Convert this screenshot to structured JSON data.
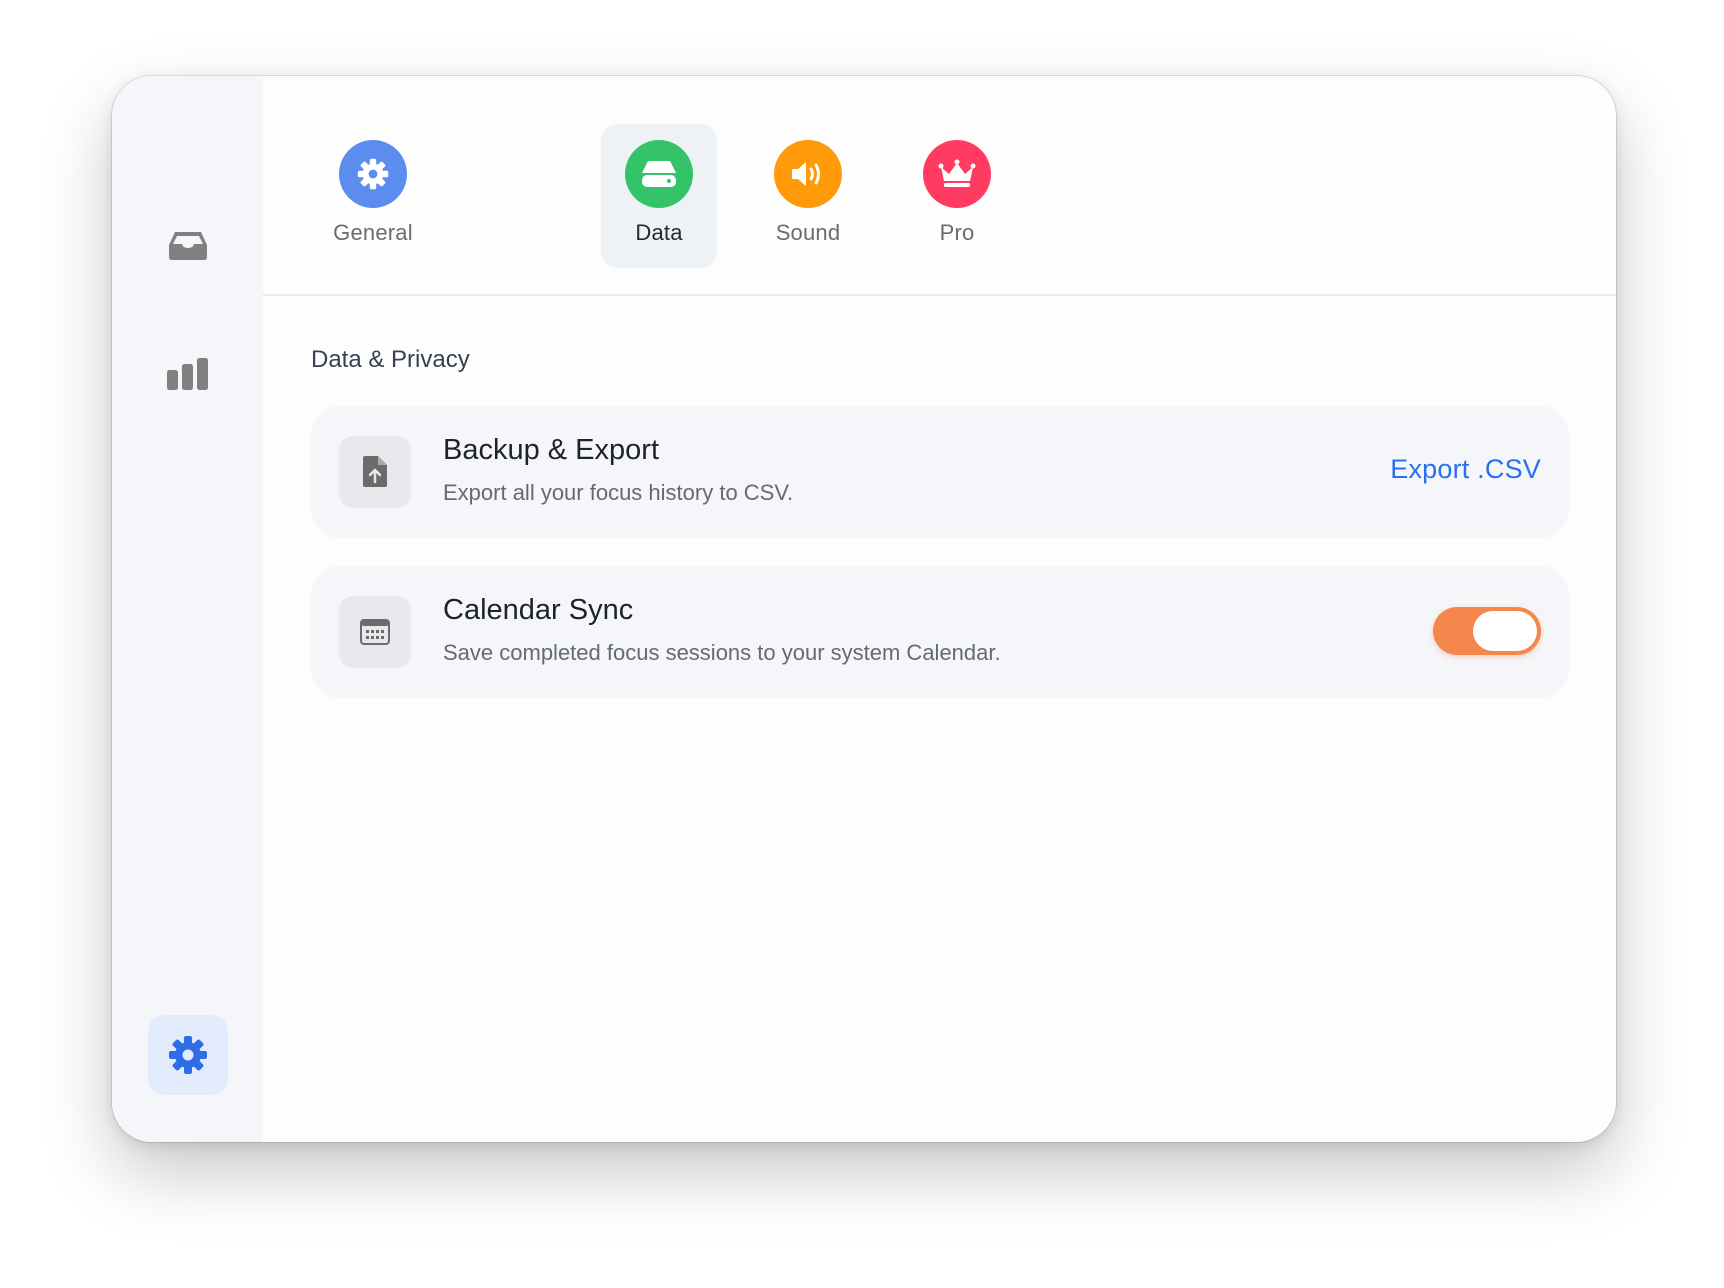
{
  "window": {
    "traffic_lights": [
      "close",
      "minimize",
      "zoom"
    ]
  },
  "sidebar": {
    "items": [
      {
        "name": "inbox",
        "icon": "inbox-tray-icon",
        "active": false
      },
      {
        "name": "stats",
        "icon": "bar-chart-icon",
        "active": false
      },
      {
        "name": "settings",
        "icon": "gear-icon",
        "active": true
      }
    ]
  },
  "tabs": [
    {
      "label": "General",
      "icon": "gear-icon",
      "color": "#5b8def",
      "active": false
    },
    {
      "label": "Data",
      "icon": "drive-icon",
      "color": "#34c369",
      "active": true
    },
    {
      "label": "Sound",
      "icon": "speaker-icon",
      "color": "#ff9a0a",
      "active": false
    },
    {
      "label": "Pro",
      "icon": "crown-icon",
      "color": "#ff3b62",
      "active": false
    }
  ],
  "main": {
    "section_title": "Data & Privacy",
    "cards": {
      "backup": {
        "icon": "file-upload-icon",
        "title": "Backup & Export",
        "subtitle": "Export all your focus history to CSV.",
        "action_label": "Export .CSV"
      },
      "calendar": {
        "icon": "calendar-icon",
        "title": "Calendar Sync",
        "subtitle": "Save completed focus sessions to your system Calendar.",
        "toggle_on": true
      }
    }
  },
  "colors": {
    "accent_blue": "#2a6ef2",
    "toggle_on": "#f5874c",
    "settings_highlight": "#e3ecfd"
  }
}
